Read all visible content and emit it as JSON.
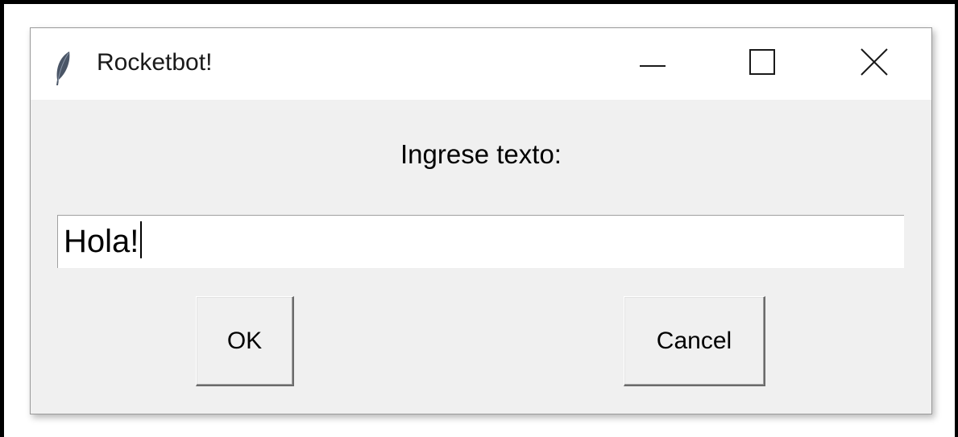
{
  "window": {
    "title": "Rocketbot!",
    "icon": "feather-icon",
    "controls": [
      "minimize-icon",
      "maximize-icon",
      "close-icon"
    ]
  },
  "dialog": {
    "prompt": "Ingrese texto:",
    "entry_value": "Hola!",
    "ok_label": "OK",
    "cancel_label": "Cancel"
  },
  "colors": {
    "window_bg": "#f0f0f0",
    "titlebar_bg": "#ffffff",
    "text": "#000000"
  }
}
